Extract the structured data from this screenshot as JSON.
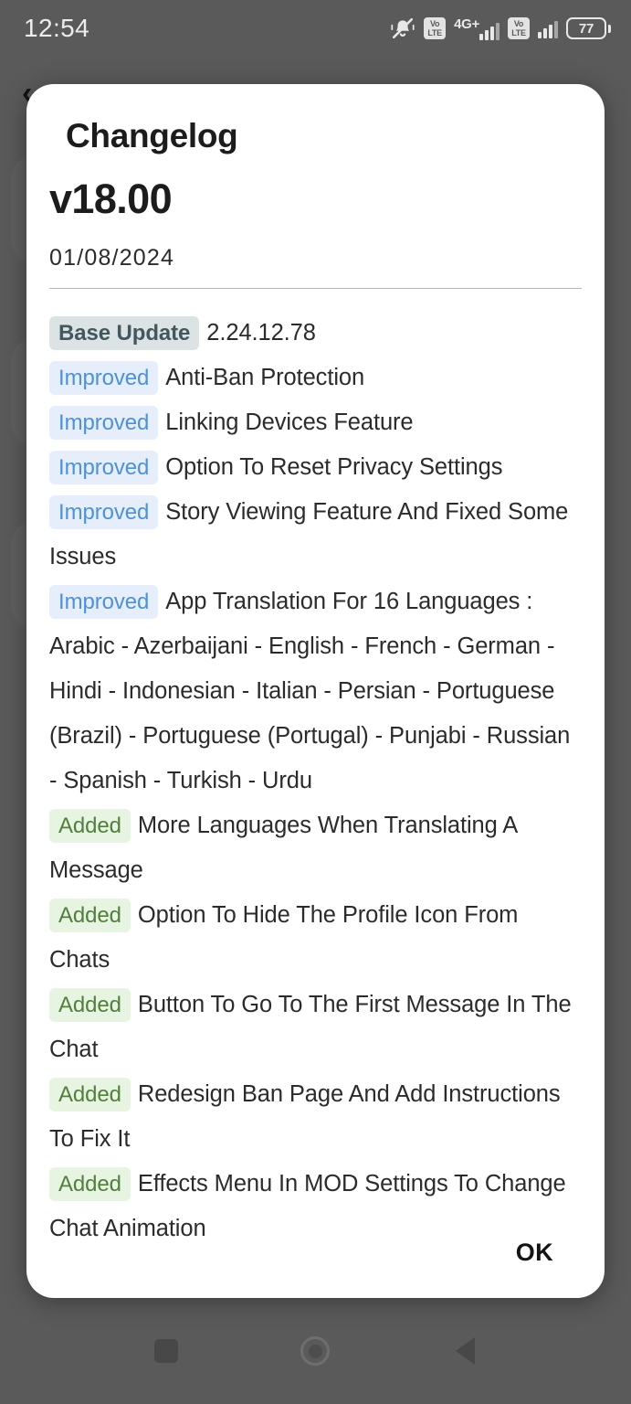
{
  "status_bar": {
    "time": "12:54",
    "icons": [
      {
        "name": "mute-icon",
        "label": "vibrate-off"
      },
      {
        "name": "volte-sim1-icon",
        "top": "Vo",
        "bottom": "LTE"
      },
      {
        "name": "network-type-label",
        "label": "4G+"
      },
      {
        "name": "signal-sim1-icon",
        "label": "signal"
      },
      {
        "name": "volte-sim2-icon",
        "top": "Vo",
        "bottom": "LTE"
      },
      {
        "name": "signal-sim2-icon",
        "label": "signal"
      }
    ],
    "battery_level": "77"
  },
  "dialog": {
    "title": "Changelog",
    "version": "v18.00",
    "date": "01/08/2024",
    "ok_label": "OK",
    "entries": [
      {
        "badge": "Base Update",
        "type": "base",
        "text": "2.24.12.78"
      },
      {
        "badge": "Improved",
        "type": "improved",
        "text": "Anti-Ban Protection"
      },
      {
        "badge": "Improved",
        "type": "improved",
        "text": "Linking Devices Feature"
      },
      {
        "badge": "Improved",
        "type": "improved",
        "text": "Option To Reset Privacy Settings"
      },
      {
        "badge": "Improved",
        "type": "improved",
        "text": "Story Viewing Feature And Fixed Some Issues"
      },
      {
        "badge": "Improved",
        "type": "improved",
        "text": "App Translation For 16 Languages : Arabic - Azerbaijani - English - French - German - Hindi - Indonesian - Italian - Persian - Portuguese (Brazil) - Portuguese (Portugal) - Punjabi - Russian - Spanish - Turkish - Urdu"
      },
      {
        "badge": "Added",
        "type": "added",
        "text": "More Languages When Translating A Message"
      },
      {
        "badge": "Added",
        "type": "added",
        "text": "Option To Hide The Profile Icon From Chats"
      },
      {
        "badge": "Added",
        "type": "added",
        "text": "Button To Go To The First Message In The Chat"
      },
      {
        "badge": "Added",
        "type": "added",
        "text": "Redesign Ban Page And Add Instructions To Fix It"
      },
      {
        "badge": "Added",
        "type": "added",
        "text": "Effects Menu In MOD Settings To Change Chat Animation"
      }
    ]
  },
  "nav_bar": {
    "recents_label": "Recents",
    "home_label": "Home",
    "back_label": "Back"
  },
  "colors": {
    "scrim": "#5a5a5a",
    "dialog_bg": "#ffffff",
    "badge_base_bg": "#dbe3e5",
    "badge_base_text": "#42585d",
    "badge_improved_bg": "#e6eefc",
    "badge_improved_text": "#4d91d6",
    "badge_added_bg": "#e7f4e1",
    "badge_added_text": "#527f3e",
    "body_text": "#2b2b2b"
  }
}
